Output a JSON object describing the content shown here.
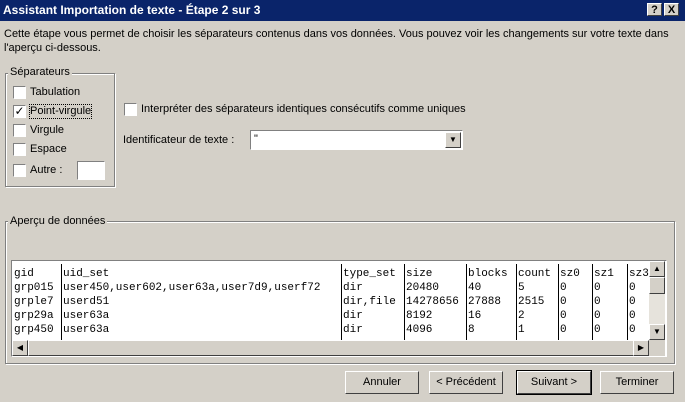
{
  "window": {
    "title": "Assistant Importation de texte - Étape 2 sur 3",
    "help_button": "?",
    "close_button": "X"
  },
  "intro_text": "Cette étape vous permet de choisir les séparateurs contenus dans vos données. Vous pouvez voir les changements sur votre texte dans l'aperçu ci-dessous.",
  "separators": {
    "legend": "Séparateurs",
    "tab": {
      "label": "Tabulation",
      "checked": false
    },
    "semicolon": {
      "label": "Point-virgule",
      "checked": true
    },
    "comma": {
      "label": "Virgule",
      "checked": false
    },
    "space": {
      "label": "Espace",
      "checked": false
    },
    "other": {
      "label": "Autre :",
      "checked": false,
      "value": ""
    }
  },
  "consecutive": {
    "label": "Interpréter des séparateurs identiques consécutifs comme uniques",
    "checked": false
  },
  "text_qualifier": {
    "label": "Identificateur de texte :",
    "value": "\""
  },
  "preview": {
    "legend": "Aperçu de données",
    "columns": [
      "gid",
      "uid_set",
      "type_set",
      "size",
      "blocks",
      "count",
      "sz0",
      "sz1",
      "sz3"
    ],
    "rows": [
      [
        "grp015",
        "user450,user602,user63a,user7d9,userf72",
        "dir",
        "20480",
        "40",
        "5",
        "0",
        "0",
        "0"
      ],
      [
        "grple7",
        "userd51",
        "dir,file",
        "14278656",
        "27888",
        "2515",
        "0",
        "0",
        "0"
      ],
      [
        "grp29a",
        "user63a",
        "dir",
        "8192",
        "16",
        "2",
        "0",
        "0",
        "0"
      ],
      [
        "grp450",
        "user63a",
        "dir",
        "4096",
        "8",
        "1",
        "0",
        "0",
        "0"
      ]
    ]
  },
  "buttons": {
    "cancel": "Annuler",
    "previous": "< Précédent",
    "next": "Suivant >",
    "finish": "Terminer"
  }
}
